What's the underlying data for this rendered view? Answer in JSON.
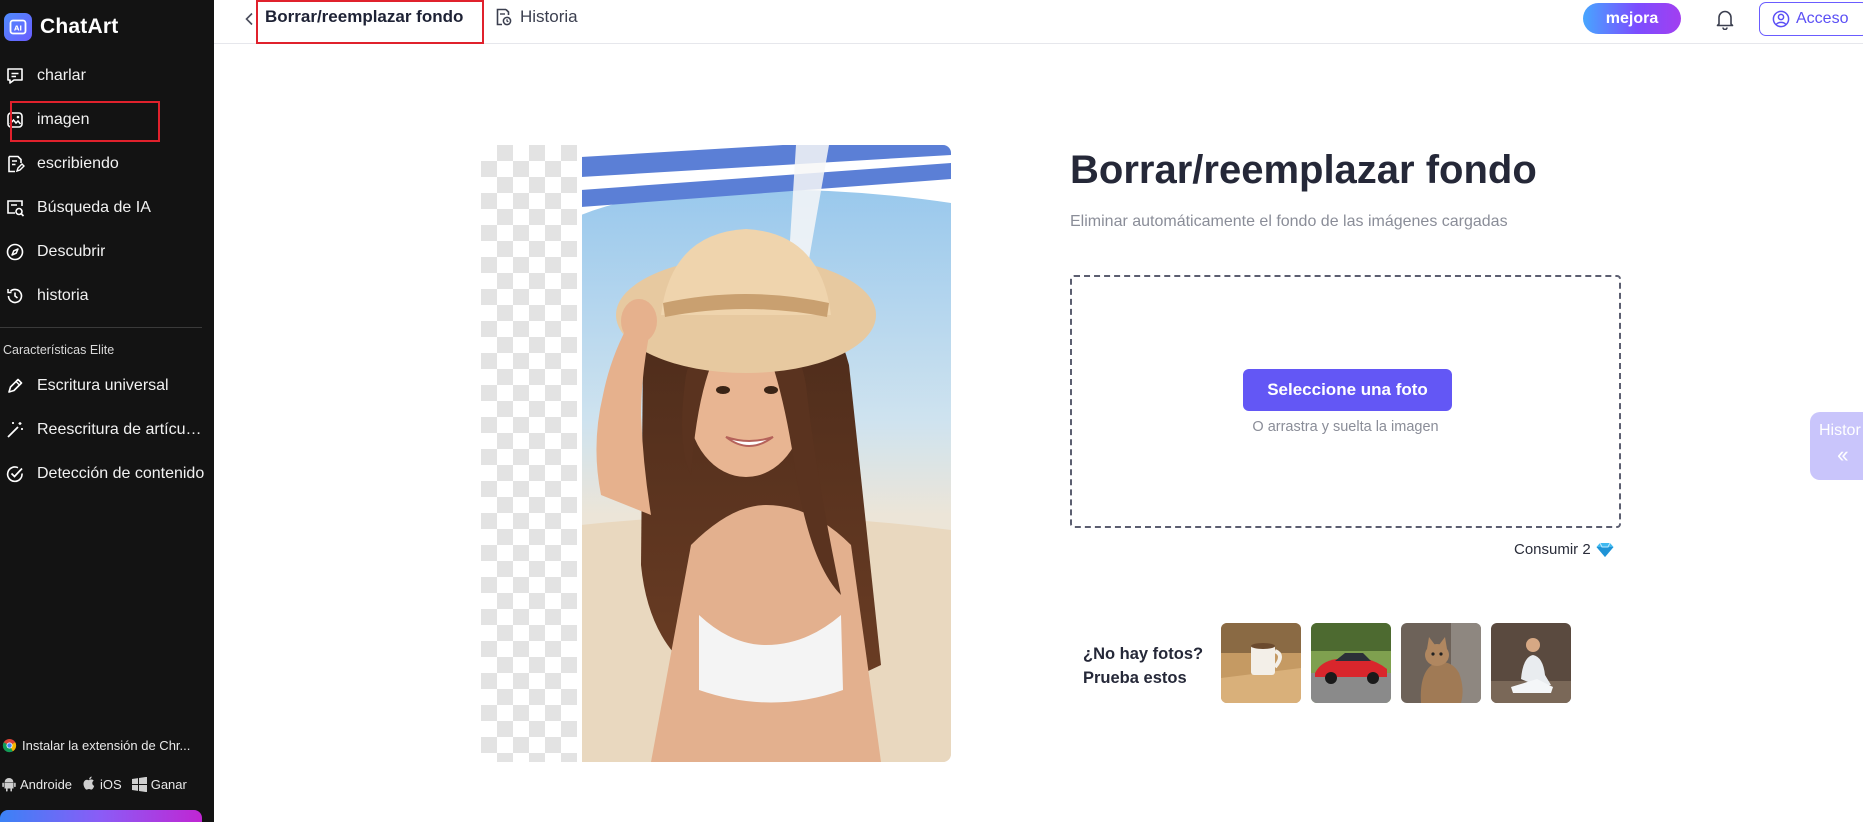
{
  "brand": {
    "name": "ChatArt",
    "logo_icon": "ai-chip-icon"
  },
  "sidebar": {
    "items": [
      {
        "label": "charlar",
        "icon": "chat-bubble-icon"
      },
      {
        "label": "imagen",
        "icon": "image-icon"
      },
      {
        "label": "escribiendo",
        "icon": "document-edit-icon"
      },
      {
        "label": "Búsqueda de IA",
        "icon": "ai-search-icon"
      },
      {
        "label": "Descubrir",
        "icon": "compass-icon"
      },
      {
        "label": "historia",
        "icon": "history-icon"
      }
    ],
    "section_title": "Características Elite",
    "elite_items": [
      {
        "label": "Escritura universal",
        "icon": "pen-icon"
      },
      {
        "label": "Reescritura de artículos",
        "icon": "magic-wand-icon"
      },
      {
        "label": "Detección de contenido",
        "icon": "check-circle-icon"
      }
    ],
    "extension_label": "Instalar la extensión de Chr...",
    "apps": {
      "android": "Androide",
      "ios": "iOS",
      "windows": "Ganar"
    }
  },
  "header": {
    "title": "Borrar/reemplazar fondo",
    "history_label": "Historia",
    "upgrade_label": "mejora",
    "login_label": "Acceso"
  },
  "main": {
    "title": "Borrar/reemplazar fondo",
    "subtitle": "Eliminar automáticamente el fondo de las imágenes cargadas",
    "select_button": "Seleccione una foto",
    "drag_hint": "O arrastra y suelta la imagen",
    "consume_label": "Consumir 2",
    "no_photos_line1": "¿No hay fotos?",
    "no_photos_line2": "Prueba estos"
  },
  "side_tab": {
    "label": "Histor"
  },
  "colors": {
    "accent": "#6357f5",
    "sidebar_bg": "#131313",
    "annotation_red": "#e0212c"
  }
}
